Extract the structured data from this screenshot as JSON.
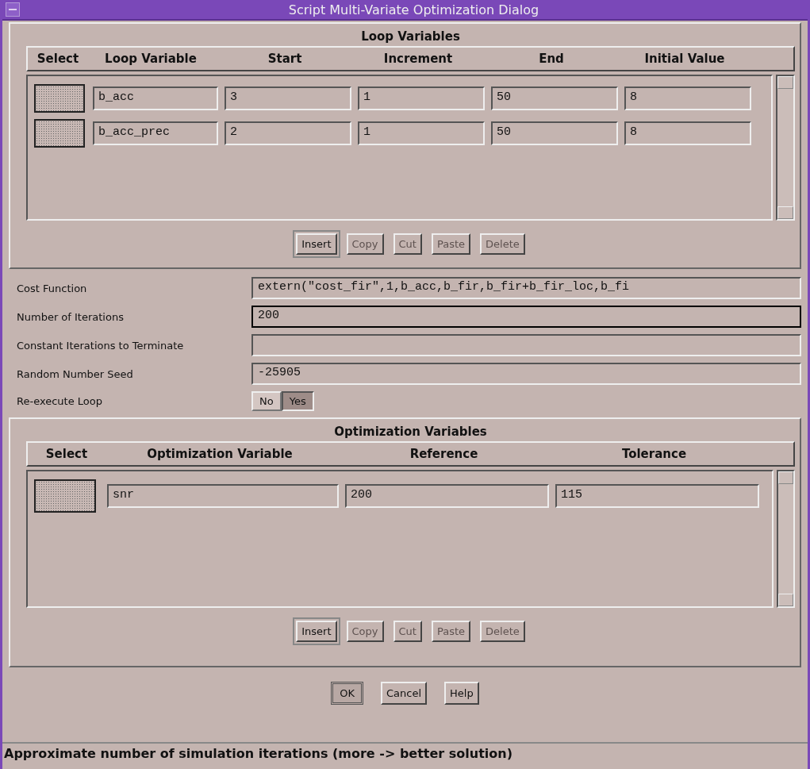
{
  "window": {
    "title": "Script Multi-Variate Optimization Dialog"
  },
  "loop_variables": {
    "title": "Loop Variables",
    "columns": [
      "Select",
      "Loop Variable",
      "Start",
      "Increment",
      "End",
      "Initial Value"
    ],
    "rows": [
      {
        "selected": false,
        "loop_variable": "b_acc",
        "start": "3",
        "increment": "1",
        "end": "50",
        "initial_value": "8"
      },
      {
        "selected": false,
        "loop_variable": "b_acc_prec",
        "start": "2",
        "increment": "1",
        "end": "50",
        "initial_value": "8"
      }
    ],
    "buttons": [
      {
        "label": "Insert",
        "disabled": false
      },
      {
        "label": "Copy",
        "disabled": true
      },
      {
        "label": "Cut",
        "disabled": true
      },
      {
        "label": "Paste",
        "disabled": true
      },
      {
        "label": "Delete",
        "disabled": true
      }
    ]
  },
  "fields": [
    {
      "label": "Cost Function",
      "value": "extern(\"cost_fir\",1,b_acc,b_fir,b_fir+b_fir_loc,b_fi",
      "focused": false
    },
    {
      "label": "Number of Iterations",
      "value": "200",
      "focused": true
    },
    {
      "label": "Constant Iterations to Terminate",
      "focused": false
    },
    {
      "label": "Random Number Seed",
      "value": "-25905",
      "focused": false
    }
  ],
  "reexecute_loop": {
    "label": "Re-execute Loop",
    "options": [
      {
        "label": "No",
        "selected": false
      },
      {
        "label": "Yes",
        "selected": true
      }
    ]
  },
  "optimization_variables": {
    "title": "Optimization Variables",
    "columns": [
      "Select",
      "Optimization Variable",
      "Reference",
      "Tolerance"
    ],
    "rows": [
      {
        "selected": false,
        "optimization_variable": "snr",
        "reference": "200",
        "tolerance": "115"
      }
    ],
    "buttons": [
      {
        "label": "Insert",
        "disabled": false
      },
      {
        "label": "Copy",
        "disabled": true
      },
      {
        "label": "Cut",
        "disabled": true
      },
      {
        "label": "Paste",
        "disabled": true
      },
      {
        "label": "Delete",
        "disabled": true
      }
    ]
  },
  "dialog_buttons": [
    {
      "label": "OK",
      "default": true
    },
    {
      "label": "Cancel",
      "default": false
    },
    {
      "label": "Help",
      "default": false
    }
  ],
  "status_bar": "Approximate number of simulation iterations (more -> better solution)"
}
